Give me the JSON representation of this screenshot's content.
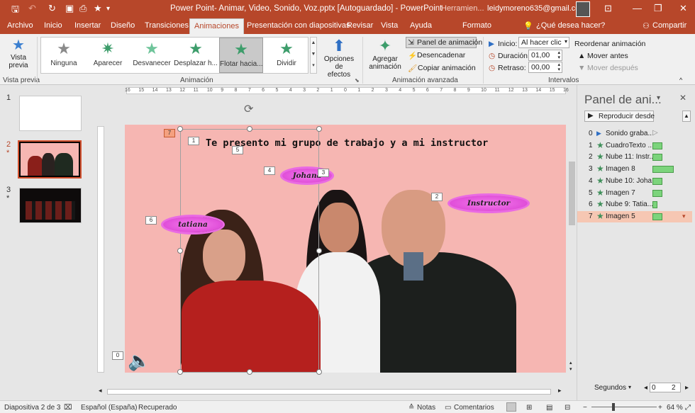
{
  "window": {
    "title": "Power Point- Animar, Video, Sonido, Voz.pptx [Autoguardado]  -  PowerPoint",
    "tools_label": "Herramien...",
    "account": "leidymoreno635@gmail.com",
    "qat_icons": [
      "save-icon",
      "undo-icon",
      "redo-icon",
      "presenter-icon",
      "star-icon"
    ]
  },
  "tabs": [
    "Archivo",
    "Inicio",
    "Insertar",
    "Diseño",
    "Transiciones",
    "Animaciones",
    "Presentación con diapositivas",
    "Revisar",
    "Vista",
    "Ayuda",
    "Formato"
  ],
  "tell_me": "¿Qué desea hacer?",
  "share": "Compartir",
  "ribbon": {
    "preview": {
      "label_1": "Vista",
      "label_2": "previa",
      "group": "Vista previa"
    },
    "gallery": [
      {
        "label": "Ninguna",
        "color": "#8a8a8a"
      },
      {
        "label": "Aparecer",
        "color": "#3d9d6b"
      },
      {
        "label": "Desvanecer",
        "color": "#6ec49a"
      },
      {
        "label": "Desplazar h...",
        "color": "#3d9d6b"
      },
      {
        "label": "Flotar hacia...",
        "color": "#3d9d6b"
      },
      {
        "label": "Dividir",
        "color": "#3d9d6b"
      }
    ],
    "effects": {
      "label_1": "Opciones de",
      "label_2": "efectos"
    },
    "animation_group": "Animación",
    "add": {
      "label_1": "Agregar",
      "label_2": "animación"
    },
    "panel_btn": "Panel de animación",
    "trigger_btn": "Desencadenar",
    "copy_btn": "Copiar animación",
    "advanced_group": "Animación avanzada",
    "start_label": "Inicio:",
    "start_value": "Al hacer clic",
    "duration_label": "Duración:",
    "duration_value": "01,00",
    "delay_label": "Retraso:",
    "delay_value": "00,00",
    "reorder": "Reordenar animación",
    "move_before": "Mover antes",
    "move_after": "Mover después",
    "timing_group": "Intervalos"
  },
  "thumbnails": [
    {
      "num": "1",
      "star": ""
    },
    {
      "num": "2",
      "star": "*"
    },
    {
      "num": "3",
      "star": "*"
    }
  ],
  "slide": {
    "title": "Te presento mi grupo de trabajo y a mi instructor",
    "clouds": {
      "johana": "Johana",
      "instructor": "Instructor",
      "tatiana": "tatiana"
    },
    "tags": {
      "t7": "7",
      "t1": "1",
      "t5": "5",
      "t4": "4",
      "t3": "3",
      "t2": "2",
      "t6": "6",
      "t0": "0"
    }
  },
  "ruler": [
    "16",
    "15",
    "14",
    "13",
    "12",
    "11",
    "10",
    "9",
    "8",
    "7",
    "6",
    "5",
    "4",
    "3",
    "2",
    "1",
    "0",
    "1",
    "2",
    "3",
    "4",
    "5",
    "6",
    "7",
    "8",
    "9",
    "10",
    "11",
    "12",
    "13",
    "14",
    "15",
    "16"
  ],
  "panel": {
    "title": "Panel de ani...",
    "play": "Reproducir desde",
    "rows": [
      {
        "num": "0",
        "label": "Sonido graba...",
        "icon": "play",
        "bar": 0
      },
      {
        "num": "1",
        "label": "CuadroTexto ...",
        "icon": "star",
        "bar": 14
      },
      {
        "num": "2",
        "label": "Nube 11: Instr...",
        "icon": "star",
        "bar": 14
      },
      {
        "num": "3",
        "label": "Imagen 8",
        "icon": "star",
        "bar": 30
      },
      {
        "num": "4",
        "label": "Nube 10: Joha...",
        "icon": "star",
        "bar": 14
      },
      {
        "num": "5",
        "label": "Imagen 7",
        "icon": "star",
        "bar": 14
      },
      {
        "num": "6",
        "label": "Nube 9: Tatia...",
        "icon": "star",
        "bar": 7
      },
      {
        "num": "7",
        "label": "Imagen 5",
        "icon": "star",
        "bar": 14
      }
    ],
    "seconds": "Segundos",
    "zero": "0",
    "two": "2"
  },
  "status": {
    "slide": "Diapositiva 2 de 3",
    "lang": "Español (España)",
    "recovered": "Recuperado",
    "notes": "Notas",
    "comments": "Comentarios",
    "zoom": "64 %"
  }
}
